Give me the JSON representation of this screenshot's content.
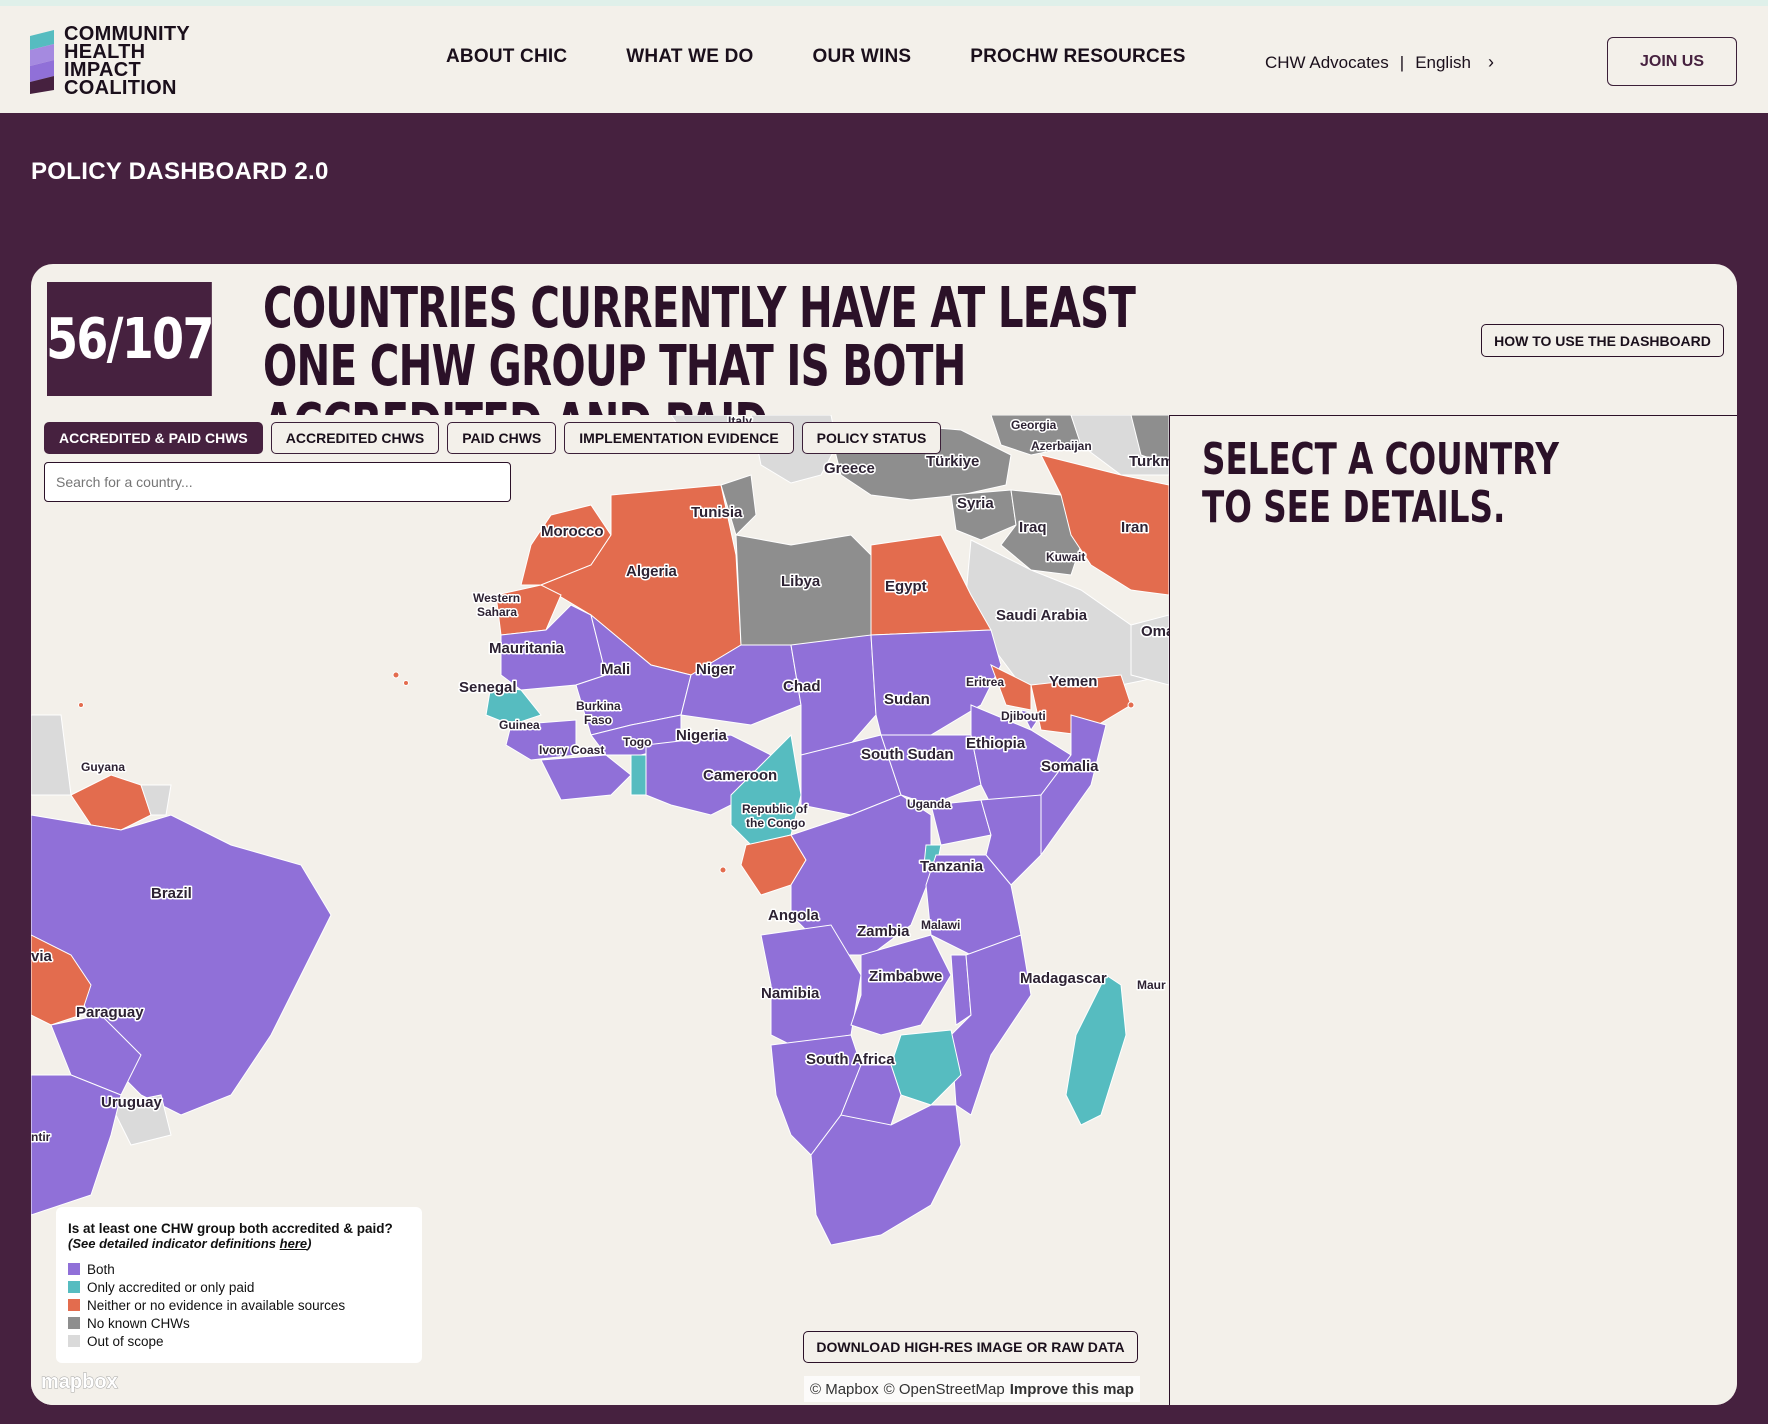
{
  "header": {
    "logo_lines": [
      "COMMUNITY",
      "HEALTH",
      "IMPACT",
      "COALITION"
    ],
    "nav": [
      {
        "label": "ABOUT CHIC"
      },
      {
        "label": "WHAT WE DO"
      },
      {
        "label": "OUR WINS"
      },
      {
        "label": "PROCHW RESOURCES"
      }
    ],
    "util_advocates": "CHW Advocates",
    "util_separator": "|",
    "util_language": "English",
    "join_label": "JOIN US"
  },
  "page": {
    "title": "POLICY DASHBOARD 2.0"
  },
  "summary": {
    "stat": "56/107",
    "headline": "COUNTRIES CURRENTLY HAVE AT LEAST ONE CHW GROUP THAT IS BOTH ACCREDITED AND PAID.",
    "howto_label": "HOW TO USE THE DASHBOARD"
  },
  "tabs": [
    {
      "label": "ACCREDITED & PAID CHWS",
      "active": true
    },
    {
      "label": "ACCREDITED CHWS",
      "active": false
    },
    {
      "label": "PAID CHWS",
      "active": false
    },
    {
      "label": "IMPLEMENTATION EVIDENCE",
      "active": false
    },
    {
      "label": "POLICY STATUS",
      "active": false
    }
  ],
  "search": {
    "placeholder": "Search for a country..."
  },
  "map": {
    "colors": {
      "both": "#9070d8",
      "only_one": "#56bcc0",
      "neither": "#e36c4e",
      "no_chws": "#8e8e8e",
      "out_of_scope": "#dadada"
    },
    "labels": [
      "Italy",
      "Georgia",
      "Azerbaijan",
      "Türkiye",
      "Turkm",
      "Greece",
      "Syria",
      "Iraq",
      "Iran",
      "Kuwait",
      "Tunisia",
      "Morocco",
      "Algeria",
      "Libya",
      "Egypt",
      "Saudi Arabia",
      "Oma",
      "Western",
      "Sahara",
      "Mauritania",
      "Mali",
      "Niger",
      "Chad",
      "Sudan",
      "Eritrea",
      "Yemen",
      "Djibouti",
      "Senegal",
      "Burkina",
      "Faso",
      "Guinea",
      "Togo",
      "Nigeria",
      "Ivory Coast",
      "Ethiopia",
      "Somalia",
      "South Sudan",
      "Cameroon",
      "Guyana",
      "Uganda",
      "Republic of",
      "the Congo",
      "Tanzania",
      "Brazil",
      "Angola",
      "Malawi",
      "Zambia",
      "Madagascar",
      "Maur",
      "Zimbabwe",
      "Namibia",
      "via",
      "Paraguay",
      "South Africa",
      "Uruguay",
      "ntir"
    ]
  },
  "legend": {
    "question": "Is at least one CHW group both accredited & paid?",
    "sub_prefix": "(See detailed indicator definitions ",
    "sub_link": "here",
    "sub_suffix": ")",
    "items": [
      {
        "label": "Both",
        "color": "#9070d8"
      },
      {
        "label": "Only accredited or only paid",
        "color": "#56bcc0"
      },
      {
        "label": "Neither or no evidence in available sources",
        "color": "#e36c4e"
      },
      {
        "label": "No known CHWs",
        "color": "#8e8e8e"
      },
      {
        "label": "Out of scope",
        "color": "#dadada"
      }
    ]
  },
  "footer": {
    "mapbox_logo": "mapbox",
    "download_label": "DOWNLOAD HIGH-RES IMAGE OR RAW DATA",
    "attrib_mapbox": "© Mapbox",
    "attrib_osm": "© OpenStreetMap",
    "attrib_improve": "Improve this map"
  },
  "side_panel": {
    "title": "SELECT A COUNTRY TO SEE DETAILS."
  }
}
